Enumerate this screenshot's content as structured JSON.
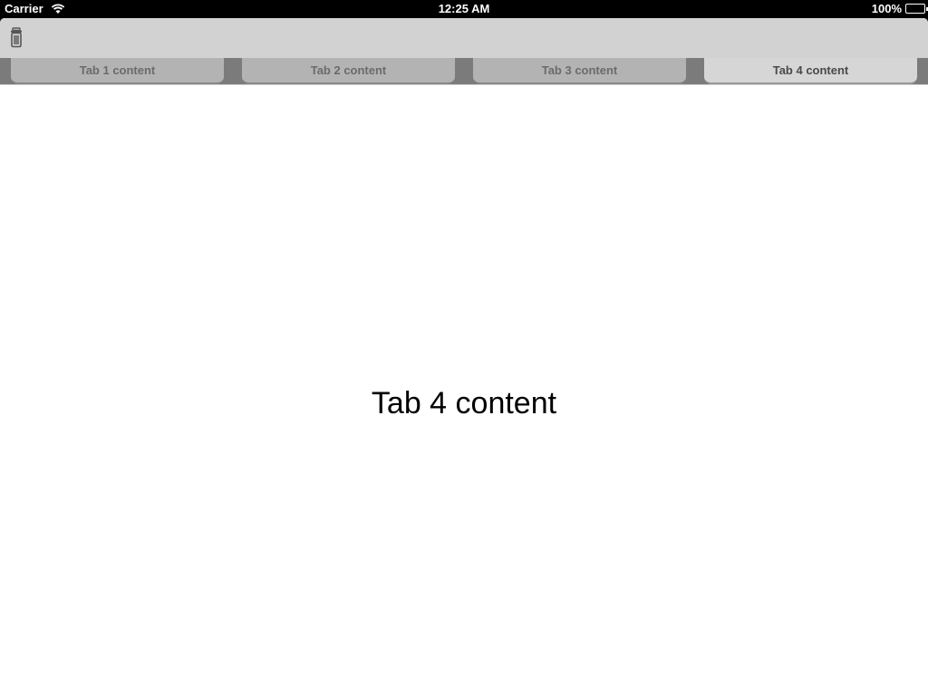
{
  "status_bar": {
    "carrier": "Carrier",
    "time": "12:25 AM",
    "battery": "100%"
  },
  "toolbar": {
    "trash_icon": "trash-icon"
  },
  "tabs": [
    {
      "label": "Tab 1 content",
      "active": false
    },
    {
      "label": "Tab 2 content",
      "active": false
    },
    {
      "label": "Tab 3 content",
      "active": false
    },
    {
      "label": "Tab 4 content",
      "active": true
    }
  ],
  "main": {
    "content_text": "Tab 4 content"
  },
  "colors": {
    "toolbar_bg": "#d2d2d2",
    "tab_inactive": "#b3b3b3",
    "tab_active": "#d6d6d6",
    "tab_separator": "#7b7b7b"
  }
}
